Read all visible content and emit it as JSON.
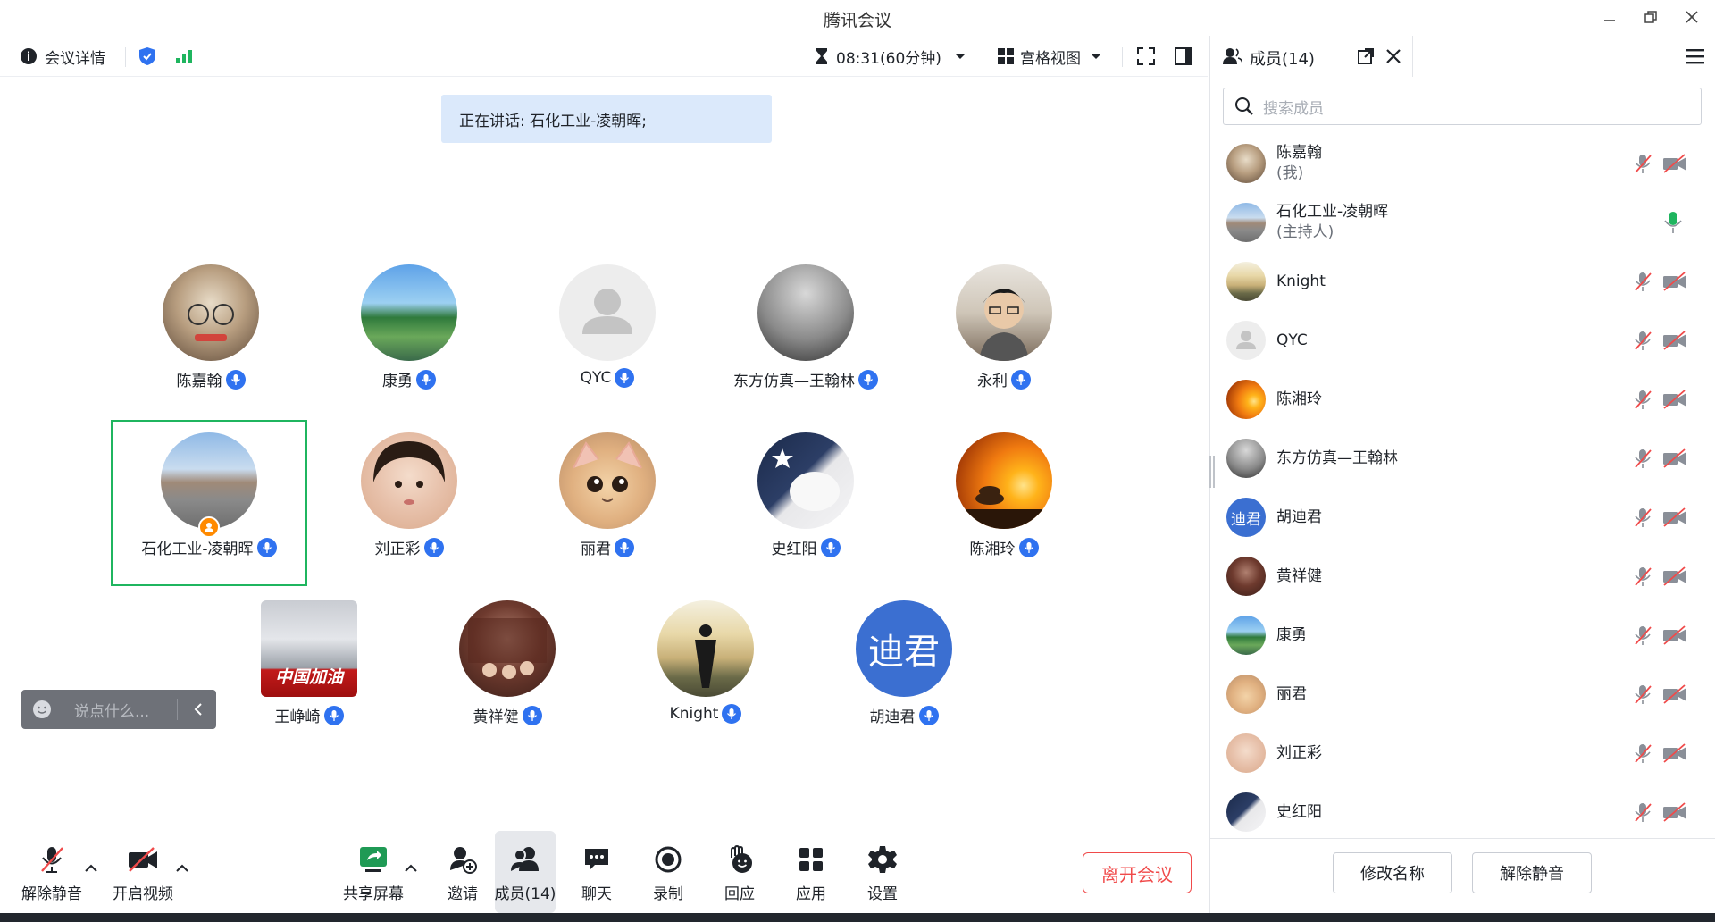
{
  "window": {
    "title": "腾讯会议"
  },
  "toolbar": {
    "meeting_info": "会议详情",
    "timer": "08:31(60分钟)",
    "view_mode": "宫格视图"
  },
  "speaking": "正在讲话: 石化工业-凌朝晖;",
  "participants": [
    {
      "name": "陈嘉翰"
    },
    {
      "name": "康勇"
    },
    {
      "name": "QYC"
    },
    {
      "name": "东方仿真—王翰林"
    },
    {
      "name": "永利"
    },
    {
      "name": "石化工业-凌朝晖"
    },
    {
      "name": "刘正彩"
    },
    {
      "name": "丽君"
    },
    {
      "name": "史红阳"
    },
    {
      "name": "陈湘玲"
    },
    {
      "name": "王峥崎",
      "avatar_text": "中国加油"
    },
    {
      "name": "黄祥健"
    },
    {
      "name": "Knight"
    },
    {
      "name": "胡迪君",
      "avatar_text": "迪君"
    }
  ],
  "chat": {
    "placeholder": "说点什么..."
  },
  "bottom": {
    "unmute": "解除静音",
    "video": "开启视频",
    "share": "共享屏幕",
    "invite": "邀请",
    "members": "成员(14)",
    "chat": "聊天",
    "record": "录制",
    "react": "回应",
    "apps": "应用",
    "settings": "设置",
    "leave": "离开会议"
  },
  "panel": {
    "title": "成员(14)",
    "search_placeholder": "搜索成员",
    "members": [
      {
        "name": "陈嘉翰",
        "sub": "(我)"
      },
      {
        "name": "石化工业-凌朝晖",
        "sub": "(主持人)"
      },
      {
        "name": "Knight"
      },
      {
        "name": "QYC"
      },
      {
        "name": "陈湘玲"
      },
      {
        "name": "东方仿真—王翰林"
      },
      {
        "name": "胡迪君",
        "avatar_text": "迪君"
      },
      {
        "name": "黄祥健"
      },
      {
        "name": "康勇"
      },
      {
        "name": "丽君"
      },
      {
        "name": "刘正彩"
      },
      {
        "name": "史红阳"
      }
    ],
    "rename": "修改名称",
    "unmute": "解除静音"
  },
  "colors": {
    "accent": "#2f72f0",
    "active_border": "#1fb55f",
    "leave": "#f04a4a",
    "host_badge": "#ff8a00"
  }
}
